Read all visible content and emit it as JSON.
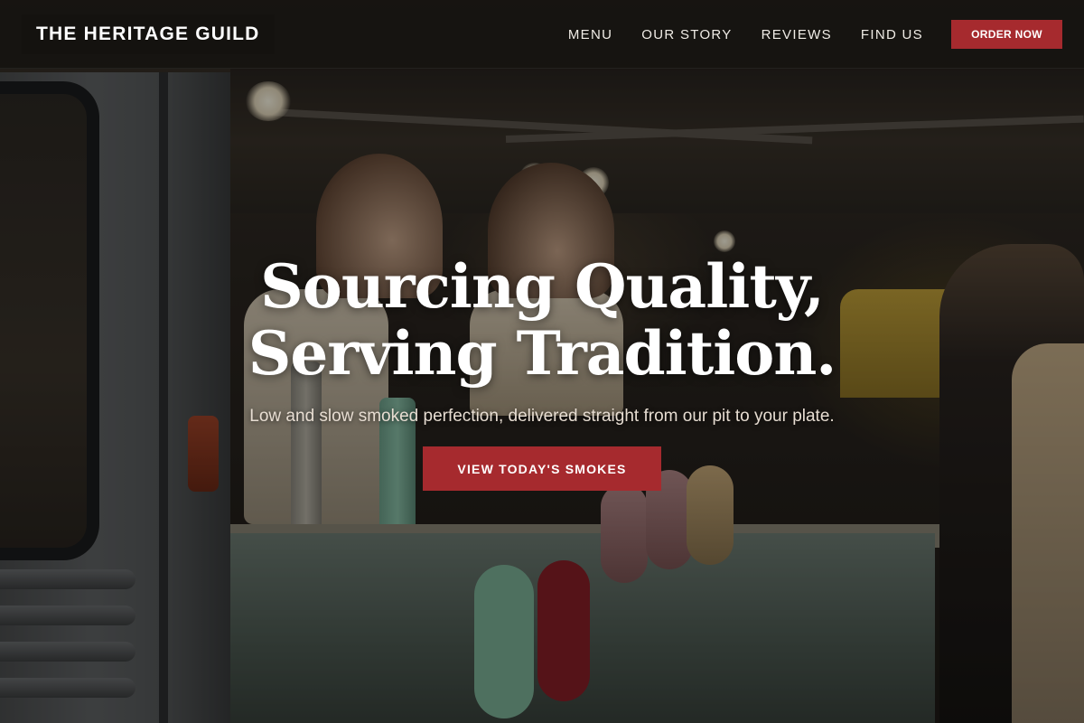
{
  "brand": {
    "name": "THE HERITAGE GUILD"
  },
  "nav": {
    "links": [
      "MENU",
      "OUR STORY",
      "REVIEWS",
      "FIND US"
    ],
    "cta_label": "ORDER NOW"
  },
  "hero": {
    "headline": "Sourcing Quality, Serving Tradition.",
    "subheadline": "Low and slow smoked perfection, delivered straight from our pit to your plate.",
    "button_label": "VIEW TODAY'S SMOKES"
  },
  "colors": {
    "accent": "#a62a2e",
    "nav_bg": "#12100e",
    "text_light": "#ffffff"
  }
}
